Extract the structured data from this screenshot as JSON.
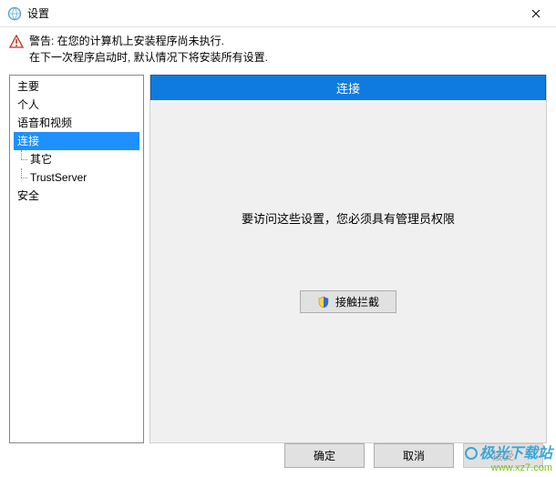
{
  "window": {
    "title": "设置"
  },
  "warning": {
    "line1": "警告: 在您的计算机上安装程序尚未执行.",
    "line2": "在下一次程序启动时, 默认情况下将安装所有设置."
  },
  "tree": {
    "items": [
      {
        "label": "主要"
      },
      {
        "label": "个人"
      },
      {
        "label": "语音和视频"
      },
      {
        "label": "连接",
        "selected": true
      },
      {
        "label": "其它",
        "child": true
      },
      {
        "label": "TrustServer",
        "child": true
      },
      {
        "label": "安全"
      }
    ]
  },
  "panel": {
    "header": "连接",
    "admin_message": "要访问这些设置，您必须具有管理员权限",
    "action_label": "接触拦截",
    "action_icon": "shield-icon"
  },
  "buttons": {
    "ok": "确定",
    "cancel": "取消",
    "apply": "接受"
  },
  "watermark": {
    "line1": "极光下载站",
    "line2": "www.xz7.com"
  },
  "colors": {
    "accent": "#0f7be0",
    "tree_selected": "#1e90ff"
  }
}
